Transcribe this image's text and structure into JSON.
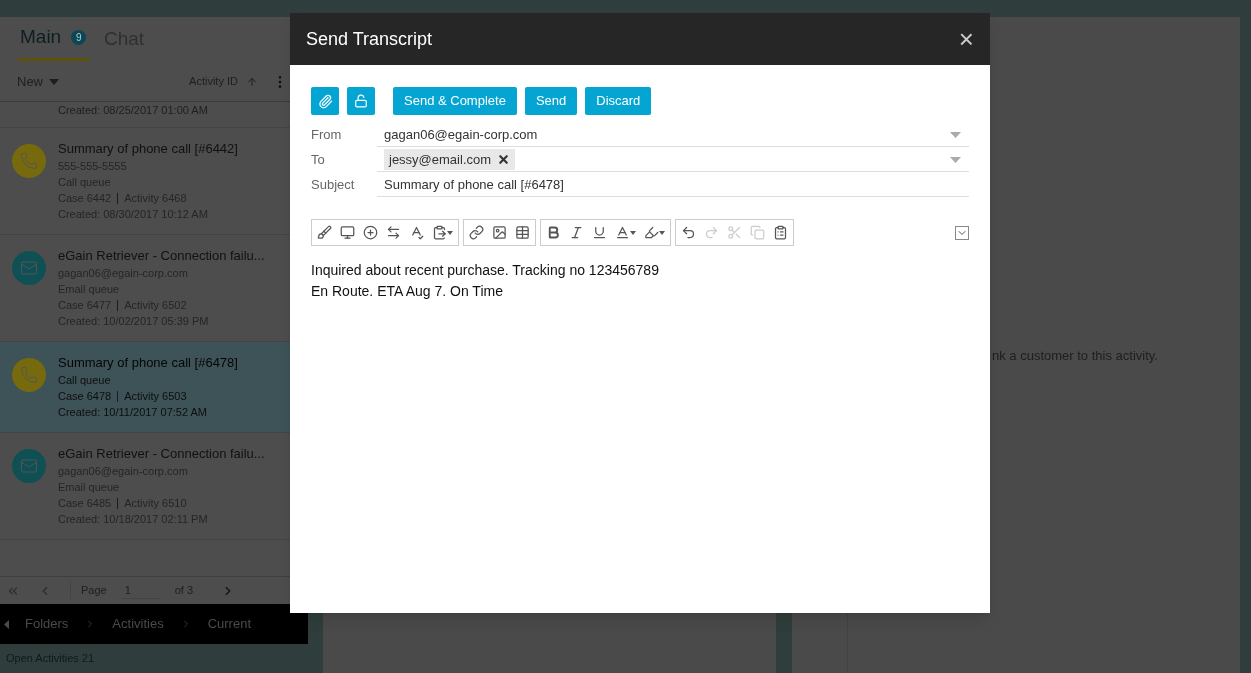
{
  "tabs": [
    {
      "label": "Main",
      "selected": true,
      "badge": "9"
    },
    {
      "label": "Chat",
      "selected": false
    }
  ],
  "list_header": {
    "filter": "New",
    "sort_label": "Activity ID"
  },
  "activities": [
    {
      "kind": "partial",
      "lines": [
        "Created: 08/25/2017 01:00 AM"
      ]
    },
    {
      "kind": "phone",
      "title": "Summary of phone call [#6442]",
      "contact": "555-555-5555",
      "queue": "Call queue",
      "case": "Case 6442",
      "activity": "Activity 6468",
      "created": "Created: 08/30/2017 10:12 AM",
      "selected": false
    },
    {
      "kind": "email",
      "title": "eGain Retriever - Connection failu...",
      "contact": "gagan06@egain-corp.com",
      "queue": "Email queue",
      "case": "Case 6477",
      "activity": "Activity 6502",
      "created": "Created: 10/02/2017 05:39 PM",
      "selected": false
    },
    {
      "kind": "phone",
      "title": "Summary of phone call [#6478]",
      "queue": "Call queue",
      "case": "Case 6478",
      "activity": "Activity 6503",
      "created": "Created: 10/11/2017 07:52 AM",
      "selected": true
    },
    {
      "kind": "email",
      "title": "eGain Retriever - Connection failu...",
      "contact": "gagan06@egain-corp.com",
      "queue": "Email queue",
      "case": "Case 6485",
      "activity": "Activity 6510",
      "created": "Created: 10/18/2017 02:11 PM",
      "selected": false
    }
  ],
  "pager": {
    "label": "Page",
    "page": "1",
    "total": "of 3"
  },
  "breadcrumb": [
    "Folders",
    "Activities",
    "Current"
  ],
  "status_bar": "Open Activities 21",
  "right_panel_text": "nk a customer to this activity.",
  "dialog": {
    "title": "Send Transcript",
    "close": "×",
    "buttons": [
      "Send & Complete",
      "Send",
      "Discard"
    ],
    "fields": [
      {
        "label": "From",
        "value": "gagan06@egain-corp.com",
        "kind": "dropdown"
      },
      {
        "label": "To",
        "chip": "jessy@email.com",
        "kind": "chips"
      },
      {
        "label": "Subject",
        "value": "Summary of phone call [#6478]",
        "kind": "text"
      }
    ],
    "body": [
      "Inquired about recent purchase. Tracking no 123456789",
      "En Route. ETA Aug 7. On Time"
    ]
  }
}
